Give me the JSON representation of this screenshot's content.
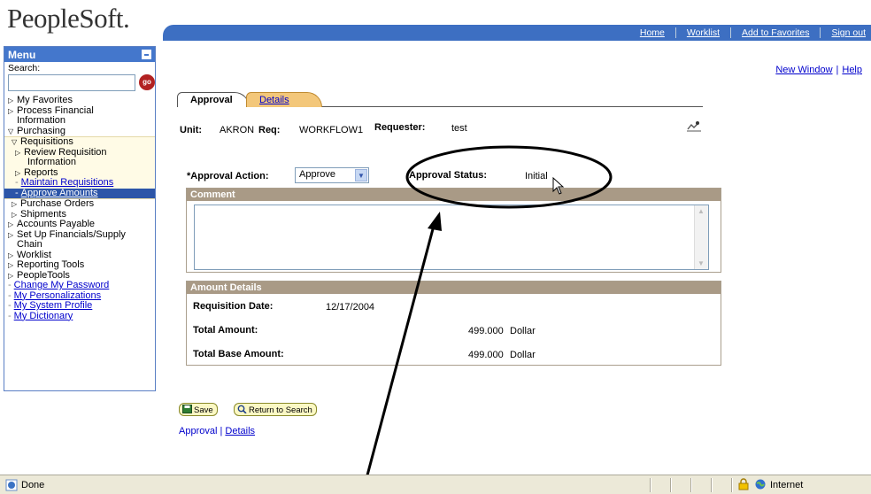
{
  "header": {
    "logo": "PeopleSoft.",
    "nav": [
      "Home",
      "Worklist",
      "Add to Favorites",
      "Sign out"
    ]
  },
  "menu": {
    "title": "Menu",
    "search_label": "Search:",
    "go_label": "go",
    "items": [
      {
        "label": "My Favorites",
        "type": "collapsed"
      },
      {
        "label": "Process Financial",
        "type": "collapsed"
      },
      {
        "label": "Information",
        "type": "cont"
      },
      {
        "label": "Purchasing",
        "type": "expanded"
      }
    ],
    "requisitions": {
      "label": "Requisitions",
      "review_1": "Review Requisition",
      "review_2": "Information",
      "reports": "Reports",
      "maintain": "Maintain Requisitions",
      "approve": "Approve Amounts"
    },
    "items_after": [
      {
        "label": "Purchase Orders",
        "cls": "l2",
        "type": "collapsed"
      },
      {
        "label": "Shipments",
        "cls": "l2",
        "type": "collapsed"
      },
      {
        "label": "Accounts Payable",
        "cls": "l1",
        "type": "collapsed"
      },
      {
        "label": "Set Up Financials/Supply",
        "cls": "l1",
        "type": "collapsed"
      },
      {
        "label": "Chain",
        "cls": "wrap1",
        "type": "cont"
      },
      {
        "label": "Worklist",
        "cls": "l1",
        "type": "collapsed"
      },
      {
        "label": "Reporting Tools",
        "cls": "l1",
        "type": "collapsed"
      },
      {
        "label": "PeopleTools",
        "cls": "l1",
        "type": "collapsed"
      },
      {
        "label": "Change My Password",
        "cls": "l1",
        "type": "link"
      },
      {
        "label": "My Personalizations",
        "cls": "l1",
        "type": "link"
      },
      {
        "label": "My System Profile",
        "cls": "l1",
        "type": "link"
      },
      {
        "label": "My Dictionary",
        "cls": "l1",
        "type": "link"
      }
    ]
  },
  "right_links": {
    "new_window": "New Window",
    "help": "Help"
  },
  "tabs": {
    "approval": "Approval",
    "details": "Details"
  },
  "form": {
    "unit_label": "Unit:",
    "unit_value": "AKRON",
    "req_label": "Req:",
    "req_value": "WORKFLOW1",
    "requester_label": "Requester:",
    "requester_value": "test",
    "approval_action_label": "*Approval Action:",
    "approval_action_value": "Approve",
    "approval_status_label": "Approval Status:",
    "approval_status_value": "Initial"
  },
  "comment": {
    "header": "Comment",
    "value": ""
  },
  "amount_details": {
    "header": "Amount Details",
    "requisition_date_label": "Requisition Date:",
    "requisition_date_value": "12/17/2004",
    "total_amount_label": "Total Amount:",
    "total_amount_value": "499.000",
    "total_amount_currency": "Dollar",
    "total_base_amount_label": "Total Base Amount:",
    "total_base_amount_value": "499.000",
    "total_base_amount_currency": "Dollar"
  },
  "buttons": {
    "save": "Save",
    "return_to_search": "Return to Search"
  },
  "bottom_links": {
    "approval": "Approval",
    "sep": "|",
    "details": "Details"
  },
  "statusbar": {
    "status": "Done",
    "zone": "Internet"
  }
}
